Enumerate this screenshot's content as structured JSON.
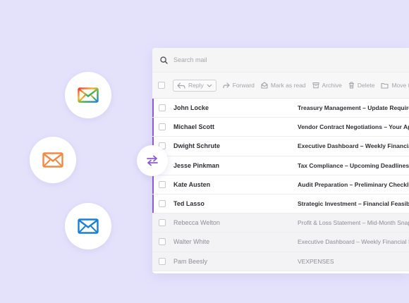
{
  "search": {
    "placeholder": "Search mail"
  },
  "toolbar": {
    "reply": "Reply",
    "forward": "Forward",
    "mark_read": "Mark as read",
    "archive": "Archive",
    "delete": "Delete",
    "move": "Move to"
  },
  "emails": [
    {
      "sender": "John Locke",
      "subject": "Treasury Management – Update Required",
      "unread": true
    },
    {
      "sender": "Michael Scott",
      "subject": "Vendor Contract Negotiations – Your Approval",
      "unread": true
    },
    {
      "sender": "Dwight Schrute",
      "subject": "Executive Dashboard – Weekly Financial Summary",
      "unread": true
    },
    {
      "sender": "Jesse Pinkman",
      "subject": "Tax Compliance – Upcoming Deadlines",
      "unread": true
    },
    {
      "sender": "Kate Austen",
      "subject": "Audit Preparation – Preliminary Checklist",
      "unread": true
    },
    {
      "sender": "Ted Lasso",
      "subject": "Strategic Investment – Financial Feasibility",
      "unread": true
    },
    {
      "sender": "Rebecca Welton",
      "subject": "Profit & Loss Statement – Mid-Month Snapshot",
      "unread": false
    },
    {
      "sender": "Walter White",
      "subject": "Executive Dashboard – Weekly Financial Summary",
      "unread": false
    },
    {
      "sender": "Pam Beesly",
      "subject": "VEXPENSES",
      "unread": false
    }
  ],
  "colors": {
    "background": "#e4e2fb",
    "accent": "#8e5ad4",
    "mail_gradient_colors": [
      "#e8423a",
      "#f7b32b",
      "#3fb34f",
      "#2d7fe0"
    ],
    "mail_orange": "#f08a46",
    "mail_blue": "#1b7fd6"
  },
  "icons": {
    "integration_1": "multicolor-mail-icon",
    "integration_2": "orange-mail-icon",
    "integration_3": "blue-mail-icon",
    "sync": "swap-arrows-icon"
  }
}
